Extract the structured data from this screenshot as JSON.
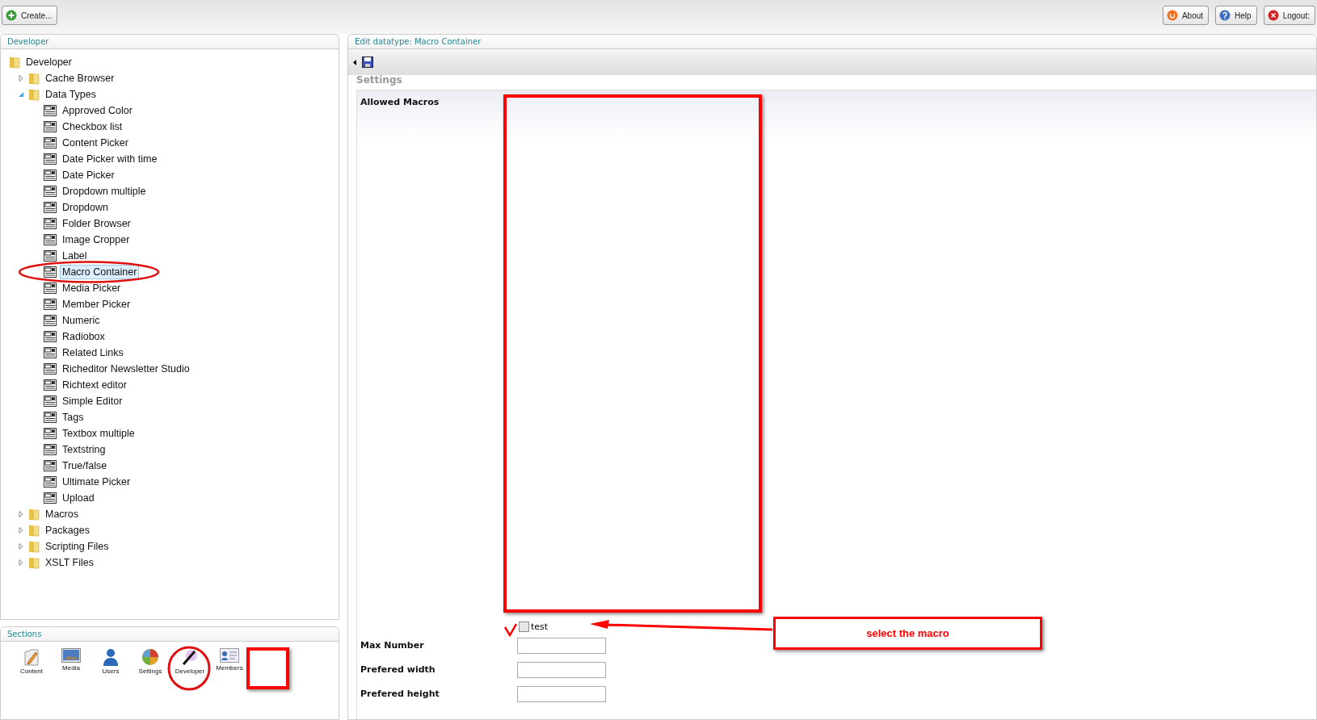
{
  "toolbar": {
    "create_button": "Create...",
    "buttons": [
      {
        "kind": "about",
        "label": "About"
      },
      {
        "kind": "help",
        "label": "Help"
      },
      {
        "kind": "logout",
        "label": "Logout:"
      }
    ]
  },
  "tree_panel": {
    "title": "Developer",
    "tree": [
      {
        "label": "Developer",
        "kind": "folder",
        "selected": false,
        "children": [
          {
            "label": "Cache Browser",
            "kind": "folder",
            "expanded": false,
            "selected": false
          },
          {
            "label": "Data Types",
            "kind": "folder",
            "expanded": true,
            "selected": false,
            "children": [
              {
                "label": "Approved Color",
                "kind": "datatype",
                "selected": false
              },
              {
                "label": "Checkbox list",
                "kind": "datatype",
                "selected": false
              },
              {
                "label": "Content Picker",
                "kind": "datatype",
                "selected": false
              },
              {
                "label": "Date Picker with time",
                "kind": "datatype",
                "selected": false
              },
              {
                "label": "Date Picker",
                "kind": "datatype",
                "selected": false
              },
              {
                "label": "Dropdown multiple",
                "kind": "datatype",
                "selected": false
              },
              {
                "label": "Dropdown",
                "kind": "datatype",
                "selected": false
              },
              {
                "label": "Folder Browser",
                "kind": "datatype",
                "selected": false
              },
              {
                "label": "Image Cropper",
                "kind": "datatype",
                "selected": false
              },
              {
                "label": "Label",
                "kind": "datatype",
                "selected": false
              },
              {
                "label": "Macro Container",
                "kind": "datatype",
                "selected": true
              },
              {
                "label": "Media Picker",
                "kind": "datatype",
                "selected": false
              },
              {
                "label": "Member Picker",
                "kind": "datatype",
                "selected": false
              },
              {
                "label": "Numeric",
                "kind": "datatype",
                "selected": false
              },
              {
                "label": "Radiobox",
                "kind": "datatype",
                "selected": false
              },
              {
                "label": "Related Links",
                "kind": "datatype",
                "selected": false
              },
              {
                "label": "Richeditor Newsletter Studio",
                "kind": "datatype",
                "selected": false
              },
              {
                "label": "Richtext editor",
                "kind": "datatype",
                "selected": false
              },
              {
                "label": "Simple Editor",
                "kind": "datatype",
                "selected": false
              },
              {
                "label": "Tags",
                "kind": "datatype",
                "selected": false
              },
              {
                "label": "Textbox multiple",
                "kind": "datatype",
                "selected": false
              },
              {
                "label": "Textstring",
                "kind": "datatype",
                "selected": false
              },
              {
                "label": "True/false",
                "kind": "datatype",
                "selected": false
              },
              {
                "label": "Ultimate Picker",
                "kind": "datatype",
                "selected": false
              },
              {
                "label": "Upload",
                "kind": "datatype",
                "selected": false
              }
            ]
          },
          {
            "label": "Macros",
            "kind": "folder",
            "expanded": false,
            "selected": false
          },
          {
            "label": "Packages",
            "kind": "folder",
            "expanded": false,
            "selected": false
          },
          {
            "label": "Scripting Files",
            "kind": "folder",
            "expanded": false,
            "selected": false
          },
          {
            "label": "XSLT Files",
            "kind": "folder",
            "expanded": false,
            "selected": false
          }
        ]
      }
    ]
  },
  "sections_panel": {
    "title": "Sections",
    "items": [
      {
        "kind": "content",
        "label": "Content"
      },
      {
        "kind": "media",
        "label": "Media"
      },
      {
        "kind": "users",
        "label": "Users"
      },
      {
        "kind": "settings",
        "label": "Settings"
      },
      {
        "kind": "developer",
        "label": "Developer"
      },
      {
        "kind": "members",
        "label": "Members"
      }
    ]
  },
  "editor": {
    "title": "Edit datatype: Macro Container",
    "tab_heading": "Settings",
    "properties": [
      {
        "kind": "checklist",
        "label": "Allowed Macros",
        "options": [
          {
            "label": "test",
            "checked": false
          }
        ]
      },
      {
        "kind": "text",
        "label": "Max Number"
      },
      {
        "kind": "text",
        "label": "Prefered width"
      },
      {
        "kind": "text",
        "label": "Prefered height"
      }
    ]
  },
  "annotation": {
    "callout": "select the macro"
  }
}
